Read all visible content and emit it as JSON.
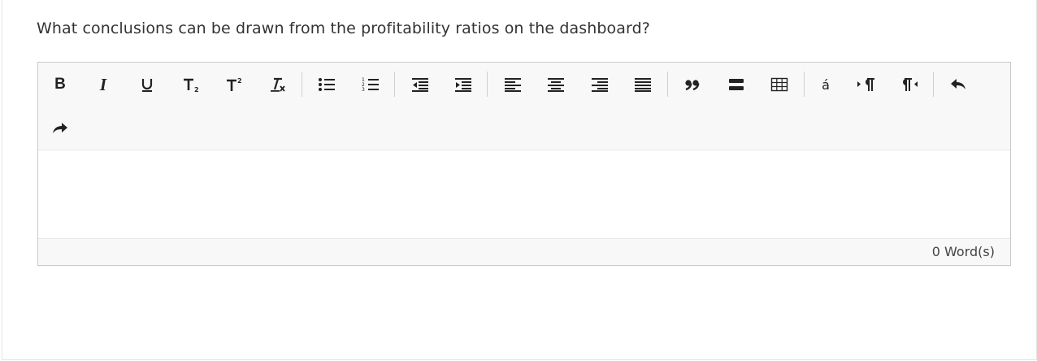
{
  "question": {
    "text": "What conclusions can be drawn from the profitability ratios on the dashboard?"
  },
  "toolbar": {
    "bold_label": "B",
    "italic_label": "I",
    "special_char_label": "á"
  },
  "status": {
    "word_count": "0 Word(s)"
  }
}
